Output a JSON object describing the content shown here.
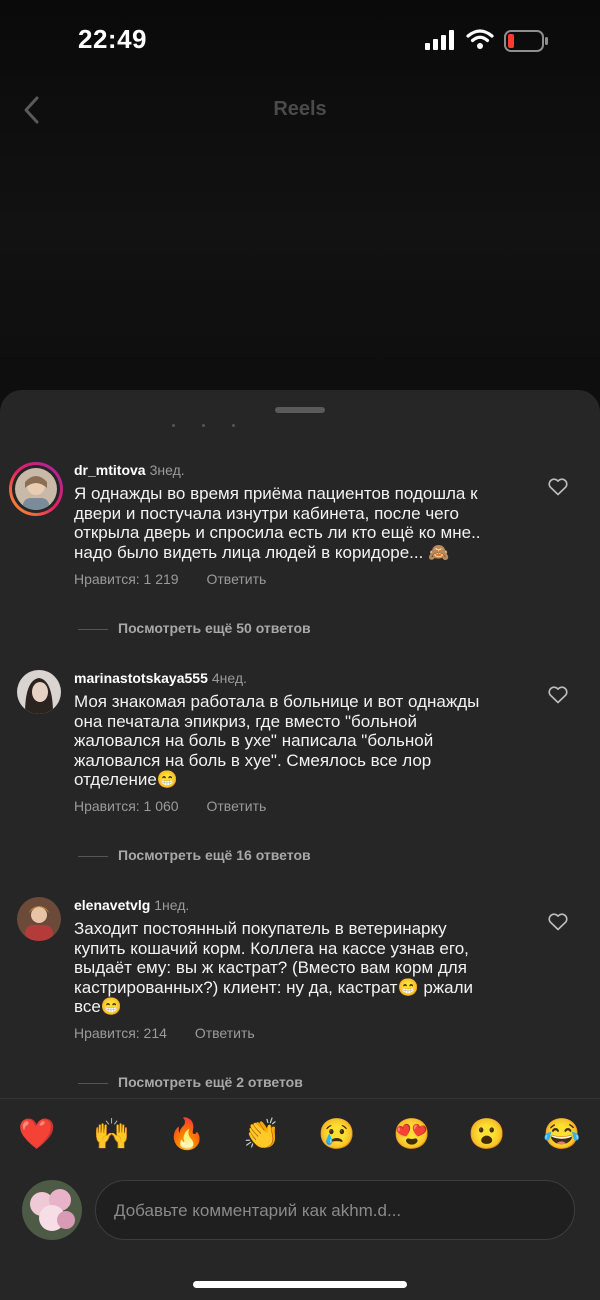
{
  "status": {
    "time": "22:49"
  },
  "header": {
    "title": "Reels"
  },
  "comments": [
    {
      "username": "dr_mtitova",
      "age": "3нед.",
      "text": "Я однажды во время приёма пациентов подошла к\nдвери и постучала изнутри кабинета, после чего\nоткрыла дверь и спросила есть ли кто ещё ко мне..\nнадо было видеть лица людей в коридоре... 🙈",
      "likes": "Нравится: 1 219",
      "reply": "Ответить",
      "more_replies": "Посмотреть ещё 50 ответов"
    },
    {
      "username": "marinastotskaya555",
      "age": "4нед.",
      "text": "Моя знакомая работала в больнице и вот однажды\nона печатала эпикриз, где вместо \"больной\nжаловался на боль в ухе\" написала \"больной\nжаловался на боль в хуе\". Смеялось все лор\nотделение😁",
      "likes": "Нравится: 1 060",
      "reply": "Ответить",
      "more_replies": "Посмотреть ещё 16 ответов"
    },
    {
      "username": "elenavetvlg",
      "age": "1нед.",
      "text": "Заходит постоянный покупатель в ветеринарку\nкупить кошачий корм. Коллега на кассе узнав его,\nвыдаёт ему: вы ж кастрат? (Вместо вам корм для\nкастрированных?) клиент: ну да, кастрат😁 ржали\nвсе😁",
      "likes": "Нравится: 214",
      "reply": "Ответить",
      "more_replies": "Посмотреть ещё 2 ответов"
    }
  ],
  "emoji_bar": [
    "❤️",
    "🙌",
    "🔥",
    "👏",
    "😢",
    "😍",
    "😮",
    "😂"
  ],
  "composer": {
    "placeholder": "Добавьте комментарий как akhm.d..."
  },
  "icons": {
    "back": "chevron-left-icon",
    "like": "heart-outline-icon",
    "signal": "signal-icon",
    "wifi": "wifi-icon",
    "battery": "battery-low-icon"
  },
  "colors": {
    "sheet": "#262626",
    "battery_low": "#ff3b30"
  }
}
